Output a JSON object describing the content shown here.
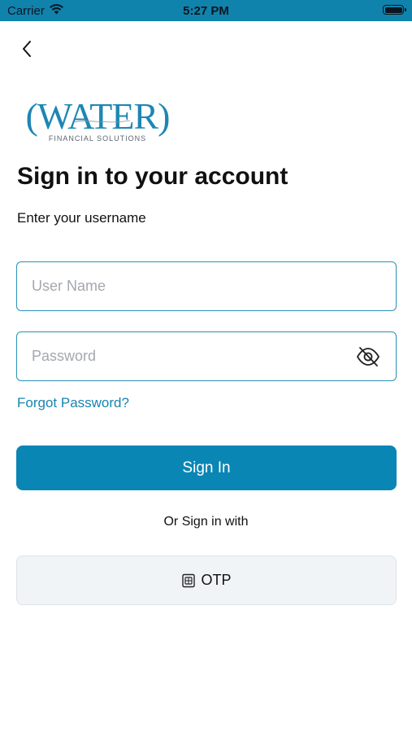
{
  "status_bar": {
    "carrier": "Carrier",
    "time": "5:27 PM",
    "icons": [
      "wifi-icon",
      "battery-icon"
    ]
  },
  "nav": {
    "back_icon": "chevron-left-icon"
  },
  "logo": {
    "wordmark": "(WATER)",
    "tagline": "FINANCIAL SOLUTIONS"
  },
  "page": {
    "title": "Sign in to your account",
    "subtitle": "Enter your username"
  },
  "form": {
    "username": {
      "value": "",
      "placeholder": "User Name"
    },
    "password": {
      "value": "",
      "placeholder": "Password",
      "visibility_icon": "eye-off-icon"
    },
    "forgot_label": "Forgot Password?",
    "signin_label": "Sign In"
  },
  "alt_signin": {
    "or_label": "Or Sign in with",
    "otp_label": "OTP",
    "otp_icon": "sim-card-icon"
  },
  "colors": {
    "accent": "#0a86b5",
    "status_bar": "#1083ad",
    "link": "#1a84b0",
    "secondary_button": "#f1f4f7"
  }
}
